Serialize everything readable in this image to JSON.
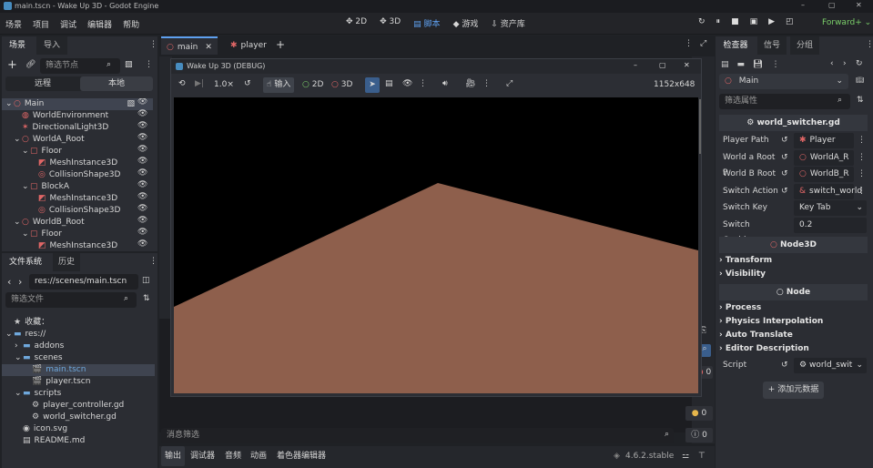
{
  "window": {
    "title": "main.tscn - Wake Up 3D - Godot Engine",
    "min": "–",
    "max": "▢",
    "close": "✕"
  },
  "menu": [
    "场景",
    "项目",
    "调试",
    "编辑器",
    "帮助"
  ],
  "workspaces": [
    {
      "icon": "✥",
      "label": "2D"
    },
    {
      "icon": "✥",
      "label": "3D"
    },
    {
      "icon": "▤",
      "label": "脚本"
    },
    {
      "icon": "◆",
      "label": "游戏"
    },
    {
      "icon": "⇩",
      "label": "资产库"
    }
  ],
  "renderer": "Forward+ ⌄",
  "scene_dock": {
    "tabs": [
      "场景",
      "导入"
    ],
    "filter_placeholder": "筛选节点",
    "mode_tabs": [
      "远程",
      "本地"
    ],
    "nodes": [
      {
        "label": "Main",
        "indent": 0,
        "color": "#e06666",
        "icon": "○",
        "arrow": "⌄",
        "selected": true
      },
      {
        "label": "WorldEnvironment",
        "indent": 1,
        "color": "#e06666",
        "icon": "◍",
        "arrow": ""
      },
      {
        "label": "DirectionalLight3D",
        "indent": 1,
        "color": "#e06666",
        "icon": "✶",
        "arrow": ""
      },
      {
        "label": "WorldA_Root",
        "indent": 1,
        "color": "#e06666",
        "icon": "○",
        "arrow": "⌄"
      },
      {
        "label": "Floor",
        "indent": 2,
        "color": "#e06666",
        "icon": "▢",
        "arrow": "⌄"
      },
      {
        "label": "MeshInstance3D",
        "indent": 3,
        "color": "#e06666",
        "icon": "◩",
        "arrow": ""
      },
      {
        "label": "CollisionShape3D",
        "indent": 3,
        "color": "#e06666",
        "icon": "◎",
        "arrow": ""
      },
      {
        "label": "BlockA",
        "indent": 2,
        "color": "#e06666",
        "icon": "▢",
        "arrow": "⌄"
      },
      {
        "label": "MeshInstance3D",
        "indent": 3,
        "color": "#e06666",
        "icon": "◩",
        "arrow": ""
      },
      {
        "label": "CollisionShape3D",
        "indent": 3,
        "color": "#e06666",
        "icon": "◎",
        "arrow": ""
      },
      {
        "label": "WorldB_Root",
        "indent": 1,
        "color": "#e06666",
        "icon": "○",
        "arrow": "⌄"
      },
      {
        "label": "Floor",
        "indent": 2,
        "color": "#e06666",
        "icon": "▢",
        "arrow": "⌄"
      },
      {
        "label": "MeshInstance3D",
        "indent": 3,
        "color": "#e06666",
        "icon": "◩",
        "arrow": ""
      }
    ]
  },
  "fs_dock": {
    "tabs": [
      "文件系统",
      "历史"
    ],
    "path": "res://scenes/main.tscn",
    "filter_placeholder": "筛选文件",
    "items": [
      {
        "label": "收藏：",
        "indent": 0,
        "icon": "★",
        "arrow": "",
        "color": "#d6d6d6"
      },
      {
        "label": "res://",
        "indent": 0,
        "icon": "▬",
        "arrow": "⌄",
        "color": "#d6d6d6"
      },
      {
        "label": "addons",
        "indent": 1,
        "icon": "▬",
        "arrow": "›",
        "color": "#d6d6d6"
      },
      {
        "label": "scenes",
        "indent": 1,
        "icon": "▬",
        "arrow": "⌄",
        "color": "#d6d6d6"
      },
      {
        "label": "main.tscn",
        "indent": 2,
        "icon": "🎬",
        "arrow": "",
        "color": "#6fa8dc",
        "selected": true
      },
      {
        "label": "player.tscn",
        "indent": 2,
        "icon": "🎬",
        "arrow": "",
        "color": "#d6d6d6"
      },
      {
        "label": "scripts",
        "indent": 1,
        "icon": "▬",
        "arrow": "⌄",
        "color": "#d6d6d6"
      },
      {
        "label": "player_controller.gd",
        "indent": 2,
        "icon": "⚙",
        "arrow": "",
        "color": "#d6d6d6"
      },
      {
        "label": "world_switcher.gd",
        "indent": 2,
        "icon": "⚙",
        "arrow": "",
        "color": "#d6d6d6"
      },
      {
        "label": "icon.svg",
        "indent": 1,
        "icon": "◉",
        "arrow": "",
        "color": "#d6d6d6"
      },
      {
        "label": "README.md",
        "indent": 1,
        "icon": "▤",
        "arrow": "",
        "color": "#d6d6d6"
      }
    ]
  },
  "editor_tabs": [
    {
      "label": "main",
      "icon": "○",
      "active": true
    },
    {
      "label": "player",
      "icon": "✱",
      "active": false
    }
  ],
  "game_window": {
    "title": "Wake Up 3D (DEBUG)",
    "speed": "1.0×",
    "input_label": "输入",
    "mode_2d": "2D",
    "mode_3d": "3D",
    "resolution": "1152x648"
  },
  "output": {
    "filter_placeholder": "消息筛选",
    "counts": [
      "0",
      "0",
      "0"
    ],
    "bottom_tabs": [
      "输出",
      "调试器",
      "音频",
      "动画",
      "着色器编辑器"
    ],
    "version": "4.6.2.stable"
  },
  "inspector": {
    "tabs": [
      "检查器",
      "信号",
      "分组"
    ],
    "node": "Main",
    "filter_placeholder": "筛选属性",
    "script_header": "world_switcher.gd",
    "props": [
      {
        "label": "Player Path",
        "value": "Player",
        "icon": "✱"
      },
      {
        "label": "World a Root P",
        "value": "WorldA_R",
        "icon": "○"
      },
      {
        "label": "World B Root",
        "value": "WorldB_R",
        "icon": "○"
      },
      {
        "label": "Switch Action",
        "value": "switch_world",
        "icon": "&"
      },
      {
        "label": "Switch Key",
        "value": "Key Tab",
        "icon": ""
      },
      {
        "label": "Switch Cooldown",
        "value": "0.2",
        "icon": ""
      }
    ],
    "node3d_header": "Node3D",
    "sections_a": [
      "Transform",
      "Visibility"
    ],
    "node_header": "Node",
    "sections_b": [
      "Process",
      "Physics Interpolation",
      "Auto Translate",
      "Editor Description"
    ],
    "script_label": "Script",
    "script_value": "world_swit",
    "add_meta": "添加元数据"
  },
  "colors": {
    "accent": "#5ea0ef",
    "node": "#e06666",
    "floor": "#8e5f4c"
  }
}
